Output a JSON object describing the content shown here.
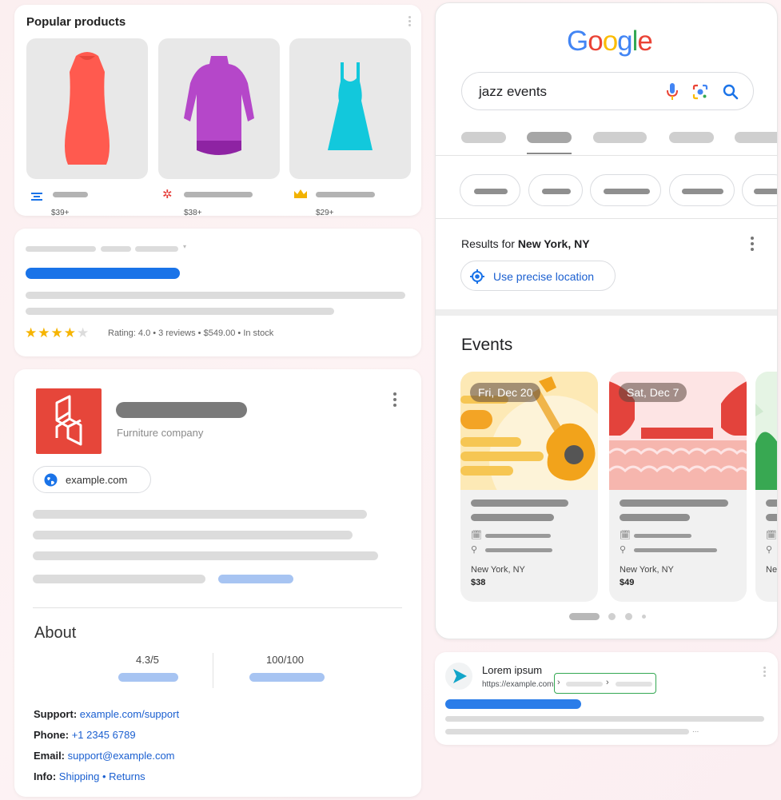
{
  "popular_products": {
    "title": "Popular products",
    "items": [
      {
        "price": "$39+",
        "color": "#ff5a4f"
      },
      {
        "price": "$38+",
        "color": "#b547c9"
      },
      {
        "price": "$29+",
        "color": "#12c8dc"
      }
    ]
  },
  "product_snippet": {
    "rating_text": "Rating: 4.0 • 3 reviews • $549.00 • In stock",
    "stars_filled": 4,
    "stars_total": 5
  },
  "business_panel": {
    "subtitle": "Furniture company",
    "website": "example.com",
    "about_title": "About",
    "score_a": "4.3/5",
    "score_b": "100/100",
    "support_label": "Support:",
    "support_value": "example.com/support",
    "phone_label": "Phone:",
    "phone_value": "+1 2345 6789",
    "email_label": "Email:",
    "email_value": "support@example.com",
    "info_label": "Info:",
    "info_value": "Shipping • Returns",
    "brand_color": "#e6463a"
  },
  "search_panel": {
    "logo": {
      "G": "G",
      "o1": "o",
      "o2": "o",
      "g": "g",
      "l": "l",
      "e": "e"
    },
    "query": "jazz events",
    "results_prefix": "Results for ",
    "location": "New York, NY",
    "precise_location_label": "Use precise location",
    "events_title": "Events",
    "events": [
      {
        "date": "Fri, Dec 20",
        "city": "New York, NY",
        "price": "$38"
      },
      {
        "date": "Sat, Dec 7",
        "city": "New York, NY",
        "price": "$49"
      },
      {
        "date": "",
        "city": "New",
        "price": ""
      }
    ]
  },
  "result_snippet": {
    "site_name": "Lorem ipsum",
    "url": "https://example.com",
    "ellipsis": "..."
  },
  "colors": {
    "google_blue": "#4285f4",
    "google_red": "#ea4335",
    "google_yellow": "#fbbc05",
    "google_green": "#34a853",
    "link_blue": "#1a73e8",
    "breadcrumb_highlight": "#34a853"
  }
}
